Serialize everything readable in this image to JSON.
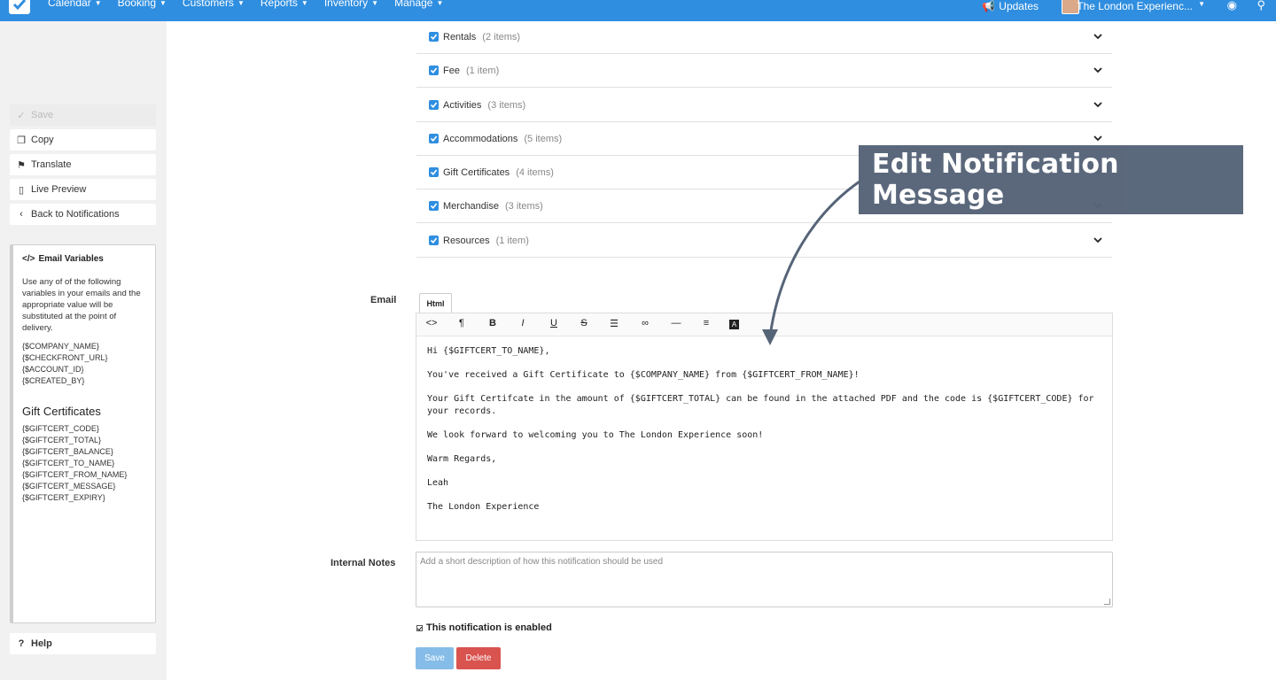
{
  "nav": {
    "items": [
      "Calendar",
      "Booking",
      "Customers",
      "Reports",
      "Inventory",
      "Manage"
    ],
    "updates": "Updates",
    "account_name": "The London Experienc..."
  },
  "sidebar": {
    "save": "Save",
    "copy": "Copy",
    "translate": "Translate",
    "live_preview": "Live Preview",
    "back": "Back to Notifications",
    "help": "Help",
    "vars_title": "Email Variables",
    "vars_desc": "Use any of of the following variables in your emails and the appropriate value will be substituted at the point of delivery.",
    "general_vars": [
      "{$COMPANY_NAME}",
      "{$CHECKFRONT_URL}",
      "{$ACCOUNT_ID}",
      "{$CREATED_BY}"
    ],
    "section_title": "Gift Certificates",
    "gift_vars": [
      "{$GIFTCERT_CODE}",
      "{$GIFTCERT_TOTAL}",
      "{$GIFTCERT_BALANCE}",
      "{$GIFTCERT_TO_NAME}",
      "{$GIFTCERT_FROM_NAME}",
      "{$GIFTCERT_MESSAGE}",
      "{$GIFTCERT_EXPIRY}"
    ]
  },
  "categories": [
    {
      "label": "Rentals",
      "count": "(2 items)"
    },
    {
      "label": "Fee",
      "count": "(1 item)"
    },
    {
      "label": "Activities",
      "count": "(3 items)"
    },
    {
      "label": "Accommodations",
      "count": "(5 items)"
    },
    {
      "label": "Gift Certificates",
      "count": "(4 items)"
    },
    {
      "label": "Merchandise",
      "count": "(3 items)"
    },
    {
      "label": "Resources",
      "count": "(1 item)"
    }
  ],
  "email": {
    "label": "Email",
    "tab": "Html",
    "body": [
      "Hi {$GIFTCERT_TO_NAME},",
      "You've received a Gift Certificate to {$COMPANY_NAME} from {$GIFTCERT_FROM_NAME}!",
      "Your Gift Certifcate in the amount of {$GIFTCERT_TOTAL} can be found in the attached PDF and the code is {$GIFTCERT_CODE} for your records.",
      "We look forward to welcoming you to The London Experience soon!",
      "Warm Regards,",
      "Leah",
      "The London Experience"
    ]
  },
  "notes": {
    "label": "Internal Notes",
    "placeholder": "Add a short description of how this notification should be used"
  },
  "enabled_label": "This notification is enabled",
  "buttons": {
    "save": "Save",
    "delete": "Delete"
  },
  "callout": "Edit Notification Message",
  "colors": {
    "nav": "#2f8ee0",
    "callout": "#566478",
    "delete": "#d9534f",
    "save": "#86bde8"
  }
}
